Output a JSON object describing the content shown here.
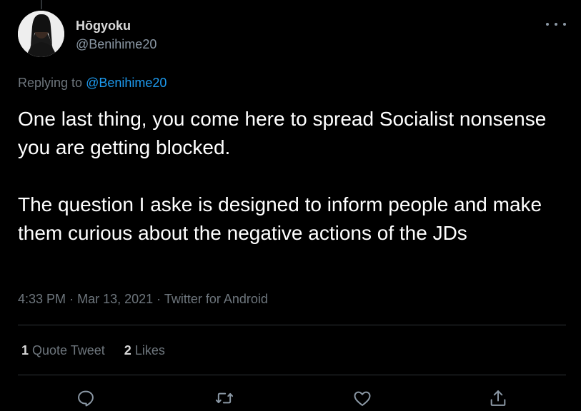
{
  "author": {
    "name": "Hōgyoku",
    "handle": "@Benihime20"
  },
  "reply": {
    "prefix": "Replying to",
    "mention": "@Benihime20"
  },
  "tweet": {
    "paragraph1": "One last thing, you come here to spread Socialist nonsense you are getting blocked.",
    "paragraph2": "The question I aske is designed to inform people and make them curious about the negative actions of the JDs"
  },
  "meta": {
    "time": "4:33 PM",
    "date": "Mar 13, 2021",
    "source": "Twitter for Android"
  },
  "stats": {
    "quote_count": "1",
    "quote_label": "Quote Tweet",
    "like_count": "2",
    "like_label": "Likes"
  },
  "icons": {
    "more": "more-dots-icon",
    "reply": "reply-icon",
    "retweet": "retweet-icon",
    "like": "like-icon",
    "share": "share-icon"
  },
  "colors": {
    "background": "#000000",
    "text": "#ffffff",
    "secondary": "#6e767d",
    "accent": "#1d9bf0",
    "divider": "#2f3336"
  }
}
